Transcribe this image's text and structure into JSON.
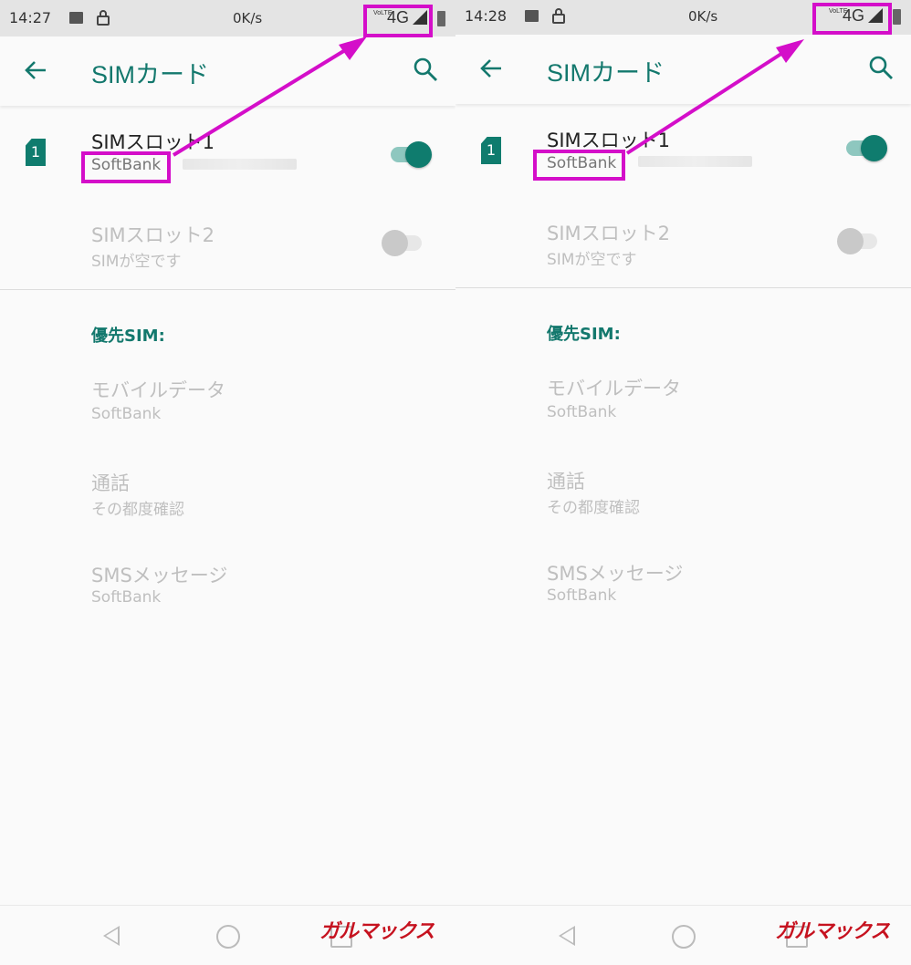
{
  "screens": [
    {
      "status": {
        "time": "14:27",
        "speed": "0K/s",
        "network": "4G",
        "volte": "VoLTE"
      },
      "title": "SIMカード",
      "slot1": {
        "title": "SIMスロット1",
        "carrier": "SoftBank"
      },
      "slot2": {
        "title": "SIMスロット2",
        "subtitle": "SIMが空です"
      },
      "section": "優先SIM:",
      "prefs": [
        {
          "title": "モバイルデータ",
          "value": "SoftBank"
        },
        {
          "title": "通話",
          "value": "その都度確認"
        },
        {
          "title": "SMSメッセージ",
          "value": "SoftBank"
        }
      ],
      "watermark": "ガルマックス",
      "sim_number": "1"
    },
    {
      "status": {
        "time": "14:28",
        "speed": "0K/s",
        "network": "4G",
        "volte": "VoLTE"
      },
      "title": "SIMカード",
      "slot1": {
        "title": "SIMスロット1",
        "carrier": "SoftBank"
      },
      "slot2": {
        "title": "SIMスロット2",
        "subtitle": "SIMが空です"
      },
      "section": "優先SIM:",
      "prefs": [
        {
          "title": "モバイルデータ",
          "value": "SoftBank"
        },
        {
          "title": "通話",
          "value": "その都度確認"
        },
        {
          "title": "SMSメッセージ",
          "value": "SoftBank"
        }
      ],
      "watermark": "ガルマックス",
      "sim_number": "1"
    }
  ],
  "colors": {
    "accent": "#13786d",
    "highlight": "#d40ec9",
    "watermark": "#c6121f"
  }
}
